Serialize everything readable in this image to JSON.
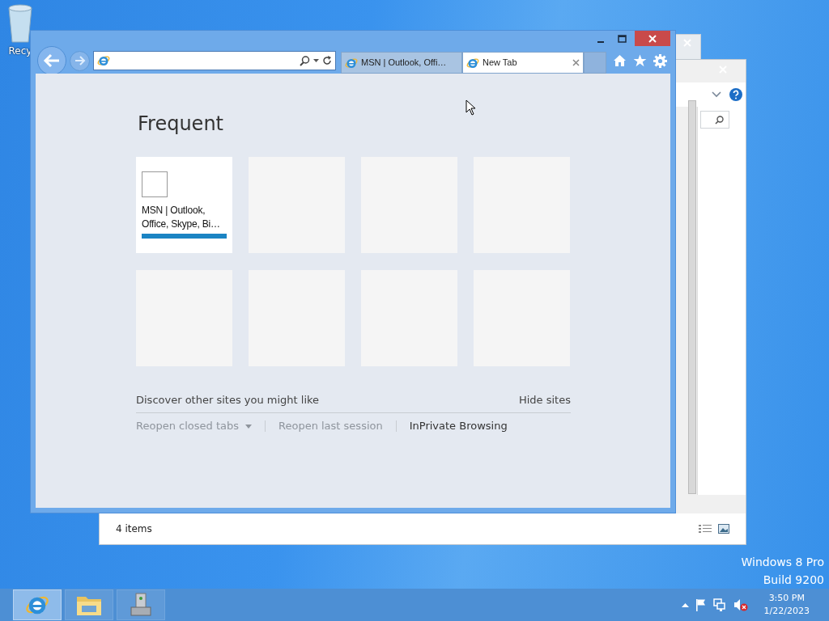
{
  "desktop": {
    "recycle_bin_label": "Recy"
  },
  "explorer": {
    "status_text": "4 items"
  },
  "browser": {
    "tabs": [
      {
        "label": "MSN | Outlook, Offi…",
        "selected": false
      },
      {
        "label": "New Tab",
        "selected": true
      }
    ],
    "new_tab_page": {
      "heading": "Frequent",
      "tiles": [
        {
          "kind": "site",
          "title": "MSN | Outlook, Office, Skype, Bi…"
        },
        {
          "kind": "empty"
        },
        {
          "kind": "empty"
        },
        {
          "kind": "empty"
        },
        {
          "kind": "empty"
        },
        {
          "kind": "empty"
        },
        {
          "kind": "empty"
        },
        {
          "kind": "empty"
        }
      ],
      "discover_text": "Discover other sites you might like",
      "hide_sites": "Hide sites",
      "links": [
        {
          "label": "Reopen closed tabs",
          "disabled": true,
          "dropdown": true
        },
        {
          "label": "Reopen last session",
          "disabled": true,
          "dropdown": false
        },
        {
          "label": "InPrivate Browsing",
          "disabled": false,
          "dropdown": false
        }
      ]
    }
  },
  "watermark": {
    "edition": "Windows 8 Pro",
    "build": "Build 9200"
  },
  "taskbar": {
    "apps": [
      {
        "kind": "browser",
        "selected": true
      },
      {
        "kind": "folder",
        "selected": false
      },
      {
        "kind": "server",
        "selected": false
      }
    ],
    "clock": {
      "time": "3:50 PM",
      "date": "1/22/2023"
    }
  }
}
